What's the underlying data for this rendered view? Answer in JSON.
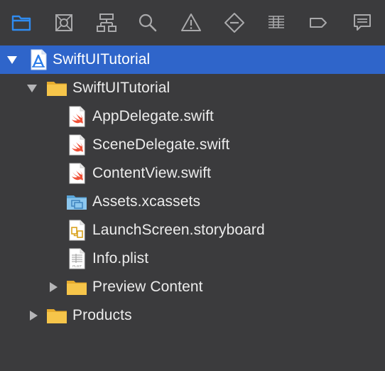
{
  "toolbar": {
    "buttons": [
      {
        "icon": "folder-icon",
        "active": true
      },
      {
        "icon": "source-control-icon",
        "active": false
      },
      {
        "icon": "hierarchy-icon",
        "active": false
      },
      {
        "icon": "search-icon",
        "active": false
      },
      {
        "icon": "warning-icon",
        "active": false
      },
      {
        "icon": "test-icon",
        "active": false
      },
      {
        "icon": "debug-icon",
        "active": false
      },
      {
        "icon": "breakpoint-icon",
        "active": false
      },
      {
        "icon": "report-icon",
        "active": false
      }
    ],
    "colors": {
      "active": "#2f8bf0",
      "inactive": "#a9a9ab"
    }
  },
  "tree": {
    "rows": [
      {
        "label": "SwiftUITutorial",
        "icon": "project-icon",
        "expanded": true,
        "selected": true
      },
      {
        "label": "SwiftUITutorial",
        "icon": "folder-icon",
        "expanded": true
      },
      {
        "label": "AppDelegate.swift",
        "icon": "swift-file-icon"
      },
      {
        "label": "SceneDelegate.swift",
        "icon": "swift-file-icon"
      },
      {
        "label": "ContentView.swift",
        "icon": "swift-file-icon"
      },
      {
        "label": "Assets.xcassets",
        "icon": "asset-catalog-icon"
      },
      {
        "label": "LaunchScreen.storyboard",
        "icon": "storyboard-icon"
      },
      {
        "label": "Info.plist",
        "icon": "plist-icon",
        "icon_text": "PLIST"
      },
      {
        "label": "Preview Content",
        "icon": "folder-icon",
        "expanded": false
      },
      {
        "label": "Products",
        "icon": "folder-icon",
        "expanded": false
      }
    ],
    "colors": {
      "selection": "#2f65ca",
      "background": "#3b3b3d",
      "folder": "#f6c54a",
      "swift": "#f05138"
    }
  }
}
